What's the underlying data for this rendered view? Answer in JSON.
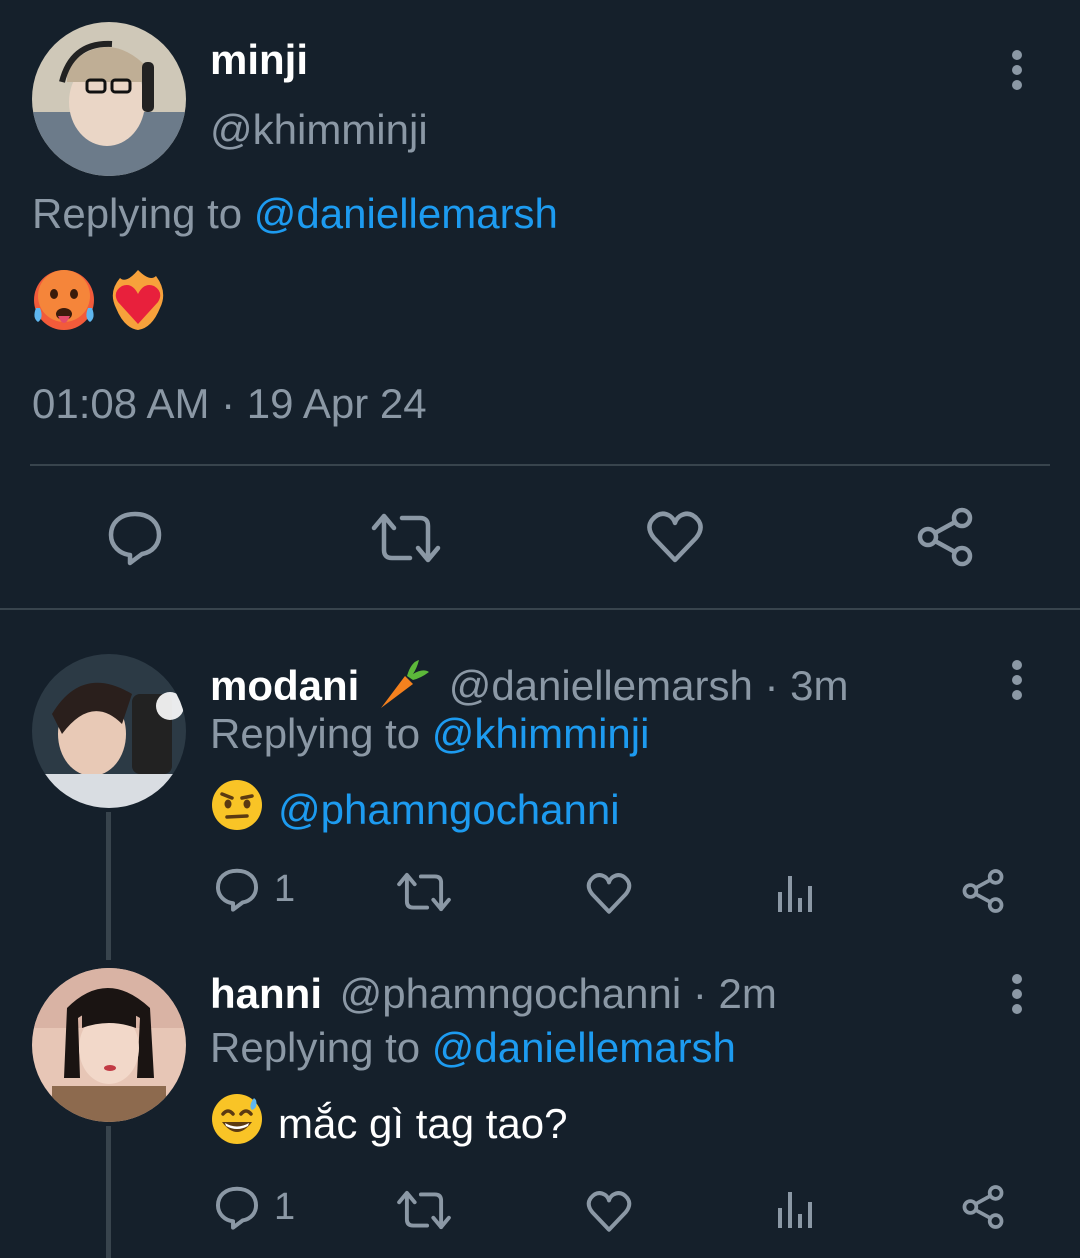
{
  "main_tweet": {
    "display_name": "minji",
    "handle": "@khimminji",
    "replying_prefix": "Replying to",
    "replying_to": "@daniellemarsh",
    "timestamp": "01:08 AM · 19 Apr 24",
    "emojis": [
      "hot-face-emoji",
      "heart-on-fire-emoji"
    ]
  },
  "replies": [
    {
      "display_name": "modani",
      "handle_time": "@daniellemarsh · 3m",
      "replying_prefix": "Replying to",
      "replying_to": "@khimminji",
      "text": "@phamngochanni",
      "reply_count": "1"
    },
    {
      "display_name": "hanni",
      "handle_time": "@phamngochanni · 2m",
      "replying_prefix": "Replying to",
      "replying_to": "@daniellemarsh",
      "text": "mắc gì tag tao?",
      "reply_count": "1"
    }
  ],
  "colors": {
    "background": "#15202b",
    "link": "#1d9bf0",
    "muted": "#8b98a5",
    "divider": "#38444d"
  }
}
